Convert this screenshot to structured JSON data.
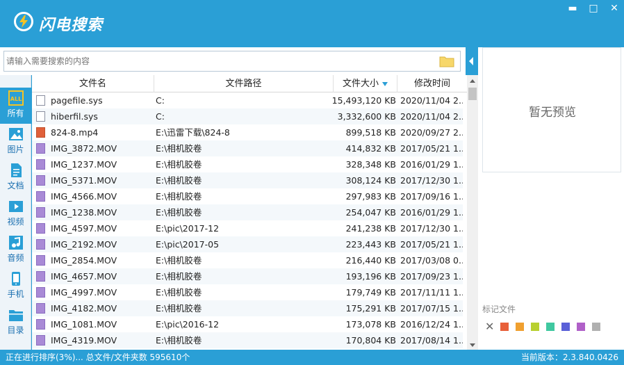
{
  "app": {
    "title": "闪电搜索"
  },
  "window": {
    "min": "▬",
    "restore": "□",
    "close": "✕"
  },
  "search": {
    "placeholder": "请输入需要搜索的内容"
  },
  "sidebar": {
    "items": [
      {
        "label": "所有",
        "icon": "all-icon"
      },
      {
        "label": "图片",
        "icon": "image-icon"
      },
      {
        "label": "文档",
        "icon": "document-icon"
      },
      {
        "label": "视频",
        "icon": "video-icon"
      },
      {
        "label": "音频",
        "icon": "audio-icon"
      },
      {
        "label": "手机",
        "icon": "phone-icon"
      },
      {
        "label": "目录",
        "icon": "folder-icon"
      }
    ]
  },
  "table": {
    "headers": {
      "name": "文件名",
      "path": "文件路径",
      "size": "文件大小",
      "date": "修改时间"
    },
    "rows": [
      {
        "type": "sys",
        "name": "pagefile.sys",
        "path": "C:",
        "size": "15,493,120 KB",
        "date": "2020/11/04 2..."
      },
      {
        "type": "sys",
        "name": "hiberfil.sys",
        "path": "C:",
        "size": "3,332,600 KB",
        "date": "2020/11/04 2..."
      },
      {
        "type": "mp4",
        "name": "824-8.mp4",
        "path": "E:\\迅雷下载\\824-8",
        "size": "899,518 KB",
        "date": "2020/09/27 2..."
      },
      {
        "type": "mov",
        "name": "IMG_3872.MOV",
        "path": "E:\\相机胶卷",
        "size": "414,832 KB",
        "date": "2017/05/21 1..."
      },
      {
        "type": "mov",
        "name": "IMG_1237.MOV",
        "path": "E:\\相机胶卷",
        "size": "328,348 KB",
        "date": "2016/01/29 1..."
      },
      {
        "type": "mov",
        "name": "IMG_5371.MOV",
        "path": "E:\\相机胶卷",
        "size": "308,124 KB",
        "date": "2017/12/30 1..."
      },
      {
        "type": "mov",
        "name": "IMG_4566.MOV",
        "path": "E:\\相机胶卷",
        "size": "297,983 KB",
        "date": "2017/09/16 1..."
      },
      {
        "type": "mov",
        "name": "IMG_1238.MOV",
        "path": "E:\\相机胶卷",
        "size": "254,047 KB",
        "date": "2016/01/29 1..."
      },
      {
        "type": "mov",
        "name": "IMG_4597.MOV",
        "path": "E:\\pic\\2017-12",
        "size": "241,238 KB",
        "date": "2017/12/30 1..."
      },
      {
        "type": "mov",
        "name": "IMG_2192.MOV",
        "path": "E:\\pic\\2017-05",
        "size": "223,443 KB",
        "date": "2017/05/21 1..."
      },
      {
        "type": "mov",
        "name": "IMG_2854.MOV",
        "path": "E:\\相机胶卷",
        "size": "216,440 KB",
        "date": "2017/03/08 0..."
      },
      {
        "type": "mov",
        "name": "IMG_4657.MOV",
        "path": "E:\\相机胶卷",
        "size": "193,196 KB",
        "date": "2017/09/23 1..."
      },
      {
        "type": "mov",
        "name": "IMG_4997.MOV",
        "path": "E:\\相机胶卷",
        "size": "179,749 KB",
        "date": "2017/11/11 1..."
      },
      {
        "type": "mov",
        "name": "IMG_4182.MOV",
        "path": "E:\\相机胶卷",
        "size": "175,291 KB",
        "date": "2017/07/15 1..."
      },
      {
        "type": "mov",
        "name": "IMG_1081.MOV",
        "path": "E:\\pic\\2016-12",
        "size": "173,078 KB",
        "date": "2016/12/24 1..."
      },
      {
        "type": "mov",
        "name": "IMG_4319.MOV",
        "path": "E:\\相机胶卷",
        "size": "170,804 KB",
        "date": "2017/08/14 1..."
      }
    ]
  },
  "preview": {
    "empty_text": "暂无预览"
  },
  "marks": {
    "label": "标记文件",
    "colors": [
      "#e8603a",
      "#f0a030",
      "#b8d030",
      "#40c8a0",
      "#5a60d8",
      "#b060c8",
      "#b0b0b0"
    ]
  },
  "status": {
    "left": "正在进行排序(3%)... 总文件/文件夹数 595610个",
    "right": "当前版本：2.3.840.0426"
  },
  "colors": {
    "accent": "#2a9fd6"
  }
}
